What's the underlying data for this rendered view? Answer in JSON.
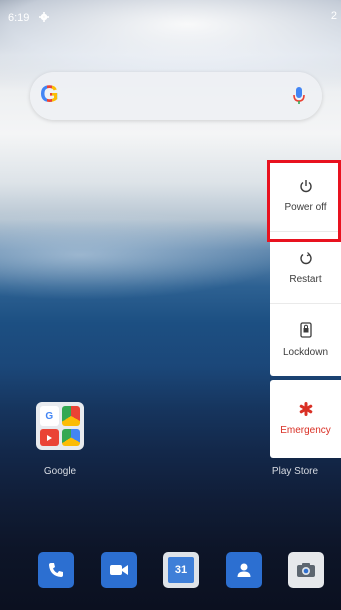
{
  "status_bar": {
    "time": "6:19",
    "right_text": "2"
  },
  "search": {
    "logo": "G"
  },
  "power_menu": {
    "items": [
      {
        "label": "Power off",
        "icon": "power-icon"
      },
      {
        "label": "Restart",
        "icon": "restart-icon"
      },
      {
        "label": "Lockdown",
        "icon": "lockdown-icon"
      }
    ],
    "emergency": {
      "label": "Emergency",
      "icon": "emergency-icon"
    }
  },
  "home": {
    "folder_label": "Google",
    "play_store_label": "Play Store"
  },
  "dock": {
    "calendar_day": "31"
  },
  "colors": {
    "highlight": "#e8121f",
    "emergency": "#d93025",
    "dock_blue": "#2c6fd1"
  }
}
